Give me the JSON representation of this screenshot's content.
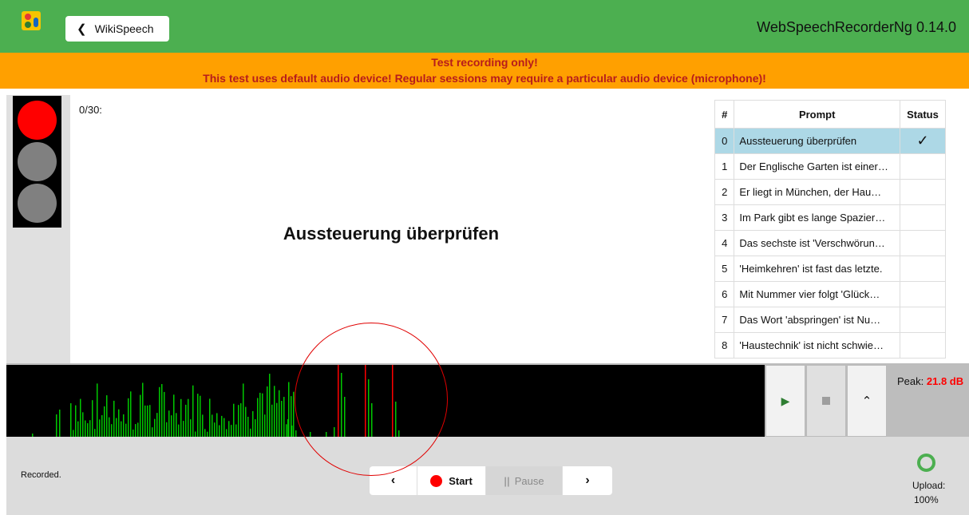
{
  "header": {
    "back_label": "WikiSpeech",
    "app_title": "WebSpeechRecorderNg 0.14.0",
    "logo_icon": "traffic-light-mic-icon",
    "bg_color": "#4caf50"
  },
  "banner": {
    "line1": "Test recording only!",
    "line2": "This test uses default audio device! Regular sessions may require a particular audio device (microphone)!",
    "bg_color": "#ffa000",
    "text_color": "#b71c1c"
  },
  "recorder": {
    "counter": "0/30:",
    "current_prompt": "Aussteuerung überprüfen",
    "traffic_light": {
      "active": "red"
    }
  },
  "prompt_list": {
    "headers": {
      "index": "#",
      "prompt": "Prompt",
      "status": "Status"
    },
    "items": [
      {
        "index": "0",
        "prompt": "Aussteuerung überprüfen",
        "status": "✓",
        "active": true
      },
      {
        "index": "1",
        "prompt": "Der Englische Garten ist einer…",
        "status": ""
      },
      {
        "index": "2",
        "prompt": "Er liegt in München, der Hau…",
        "status": ""
      },
      {
        "index": "3",
        "prompt": "Im Park gibt es lange Spazier…",
        "status": ""
      },
      {
        "index": "4",
        "prompt": "Das sechste ist 'Verschwörun…",
        "status": ""
      },
      {
        "index": "5",
        "prompt": "'Heimkehren' ist fast das letzte.",
        "status": ""
      },
      {
        "index": "6",
        "prompt": "Mit Nummer vier folgt 'Glück…",
        "status": ""
      },
      {
        "index": "7",
        "prompt": "Das Wort 'abspringen' ist Nu…",
        "status": ""
      },
      {
        "index": "8",
        "prompt": "'Haustechnik' ist nicht schwie…",
        "status": ""
      }
    ]
  },
  "audio": {
    "peak_label": "Peak:",
    "peak_value": "21.8 dB",
    "level_color": "#00c800",
    "clip_color": "#ff0000"
  },
  "bottom": {
    "status": "Recorded.",
    "start_label": "Start",
    "pause_label": "Pause",
    "upload_label": "Upload:",
    "upload_value": "100%"
  }
}
